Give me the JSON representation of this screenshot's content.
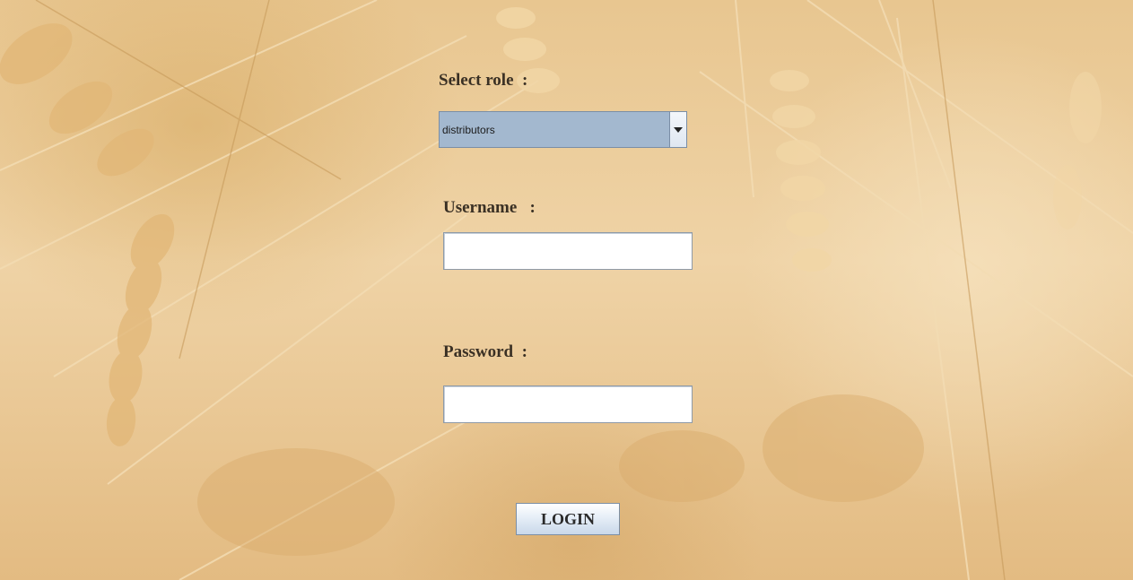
{
  "form": {
    "role_label": "Select role  :",
    "role_selected": "distributors",
    "username_label": "Username   :",
    "username_value": "",
    "password_label": "Password  :",
    "password_value": "",
    "login_label": "LOGIN"
  },
  "colors": {
    "background": "#e9c999",
    "combo": "#a3b8cf",
    "label_text": "#3a3024"
  },
  "icons": {
    "dropdown": "chevron-down-icon"
  }
}
